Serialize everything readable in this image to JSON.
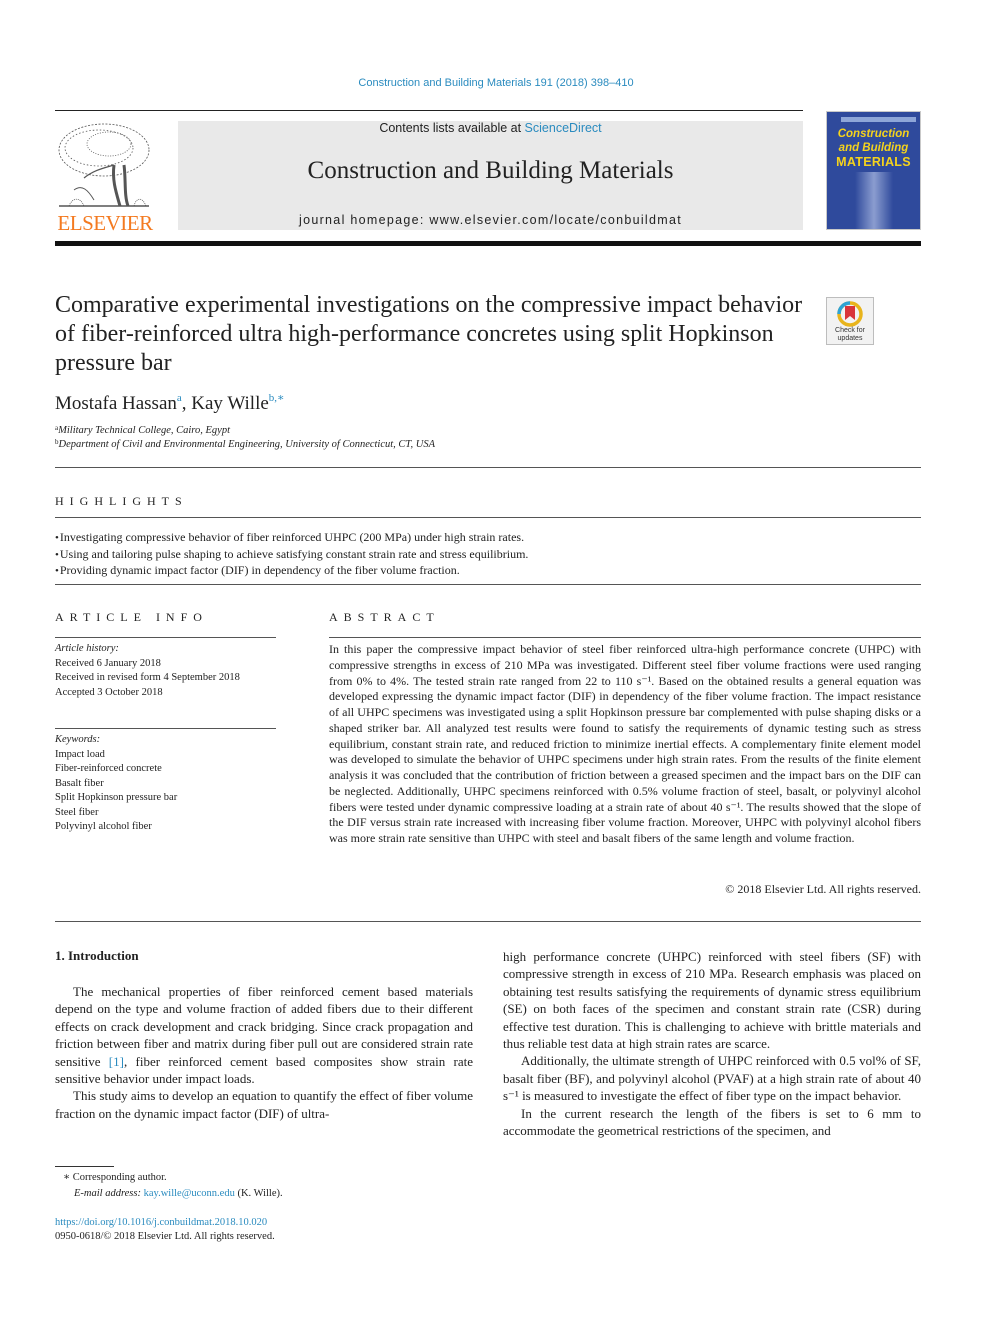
{
  "header": {
    "journal_reference": "Construction and Building Materials 191 (2018) 398–410",
    "contents_prefix": "Contents lists available at ",
    "contents_link": "ScienceDirect",
    "journal_title": "Construction and Building Materials",
    "homepage": "journal homepage: www.elsevier.com/locate/conbuildmat",
    "publisher_logo_text": "ELSEVIER",
    "cover": {
      "line1": "Construction",
      "line2": "and Building",
      "line3": "MATERIALS"
    },
    "colors": {
      "link": "#2a8bbf",
      "elsevier_orange": "#f47a20",
      "cover_blue": "#2f4a9c",
      "cover_yellow": "#f5d31c"
    }
  },
  "article": {
    "title": "Comparative experimental investigations on the compressive impact behavior of fiber-reinforced ultra high-performance concretes using split Hopkinson pressure bar",
    "crossmark_label": "Check for updates",
    "authors": [
      {
        "name": "Mostafa Hassan",
        "sup": "a"
      },
      {
        "name": "Kay Wille",
        "sup": "b,∗"
      }
    ],
    "author_separator": ", ",
    "affiliations": [
      {
        "sup": "a",
        "text": "Military Technical College, Cairo, Egypt"
      },
      {
        "sup": "b",
        "text": "Department of Civil and Environmental Engineering, University of Connecticut, CT, USA"
      }
    ]
  },
  "highlights": {
    "heading": "HIGHLIGHTS",
    "items": [
      "Investigating compressive behavior of fiber reinforced UHPC (200 MPa) under high strain rates.",
      "Using and tailoring pulse shaping to achieve satisfying constant strain rate and stress equilibrium.",
      "Providing dynamic impact factor (DIF) in dependency of the fiber volume fraction."
    ]
  },
  "article_info": {
    "heading": "ARTICLE INFO",
    "history_label": "Article history:",
    "history": [
      "Received 6 January 2018",
      "Received in revised form 4 September 2018",
      "Accepted 3 October 2018"
    ],
    "keywords_label": "Keywords:",
    "keywords": [
      "Impact load",
      "Fiber-reinforced concrete",
      "Basalt fiber",
      "Split Hopkinson pressure bar",
      "Steel fiber",
      "Polyvinyl alcohol fiber"
    ]
  },
  "abstract": {
    "heading": "ABSTRACT",
    "text": "In this paper the compressive impact behavior of steel fiber reinforced ultra-high performance concrete (UHPC) with compressive strengths in excess of 210 MPa was investigated. Different steel fiber volume fractions were used ranging from 0% to 4%. The tested strain rate ranged from 22 to 110 s⁻¹. Based on the obtained results a general equation was developed expressing the dynamic impact factor (DIF) in dependency of the fiber volume fraction. The impact resistance of all UHPC specimens was investigated using a split Hopkinson pressure bar complemented with pulse shaping disks or a shaped striker bar. All analyzed test results were found to satisfy the requirements of dynamic testing such as stress equilibrium, constant strain rate, and reduced friction to minimize inertial effects. A complementary finite element model was developed to simulate the behavior of UHPC specimens under high strain rates. From the results of the finite element analysis it was concluded that the contribution of friction between a greased specimen and the impact bars on the DIF can be neglected. Additionally, UHPC specimens reinforced with 0.5% volume fraction of steel, basalt, or polyvinyl alcohol fibers were tested under dynamic compressive loading at a strain rate of about 40 s⁻¹. The results showed that the slope of the DIF versus strain rate increased with increasing fiber volume fraction. Moreover, UHPC with polyvinyl alcohol fibers was more strain rate sensitive than UHPC with steel and basalt fibers of the same length and volume fraction.",
    "copyright": "© 2018 Elsevier Ltd. All rights reserved."
  },
  "body": {
    "section_heading": "1. Introduction",
    "left_paragraphs": {
      "p1_before_ref": "The mechanical properties of fiber reinforced cement based materials depend on the type and volume fraction of added fibers due to their different effects on crack development and crack bridging. Since crack propagation and friction between fiber and matrix during fiber pull out are considered strain rate sensitive ",
      "p1_ref": "[1]",
      "p1_after_ref": ", fiber reinforced cement based composites show strain rate sensitive behavior under impact loads.",
      "p2": "This study aims to develop an equation to quantify the effect of fiber volume fraction on the dynamic impact factor (DIF) of ultra-"
    },
    "right_paragraphs": [
      "high performance concrete (UHPC) reinforced with steel fibers (SF) with compressive strength in excess of 210 MPa. Research emphasis was placed on obtaining test results satisfying the requirements of dynamic stress equilibrium (SE) on both faces of the specimen and constant strain rate (CSR) during effective test duration. This is challenging to achieve with brittle materials and thus reliable test data at high strain rates are scarce.",
      "Additionally, the ultimate strength of UHPC reinforced with 0.5 vol% of SF, basalt fiber (BF), and polyvinyl alcohol (PVAF) at a high strain rate of about 40 s⁻¹ is measured to investigate the effect of fiber type on the impact behavior.",
      "In the current research the length of the fibers is set to 6 mm to accommodate the geometrical restrictions of the specimen, and"
    ]
  },
  "footnotes": {
    "corresponding_marker": "∗",
    "corresponding_text": "Corresponding author.",
    "email_label": "E-mail address:",
    "email": "kay.wille@uconn.edu",
    "email_suffix": " (K. Wille)."
  },
  "footer": {
    "doi": "https://doi.org/10.1016/j.conbuildmat.2018.10.020",
    "issn_copyright": "0950-0618/© 2018 Elsevier Ltd. All rights reserved."
  }
}
